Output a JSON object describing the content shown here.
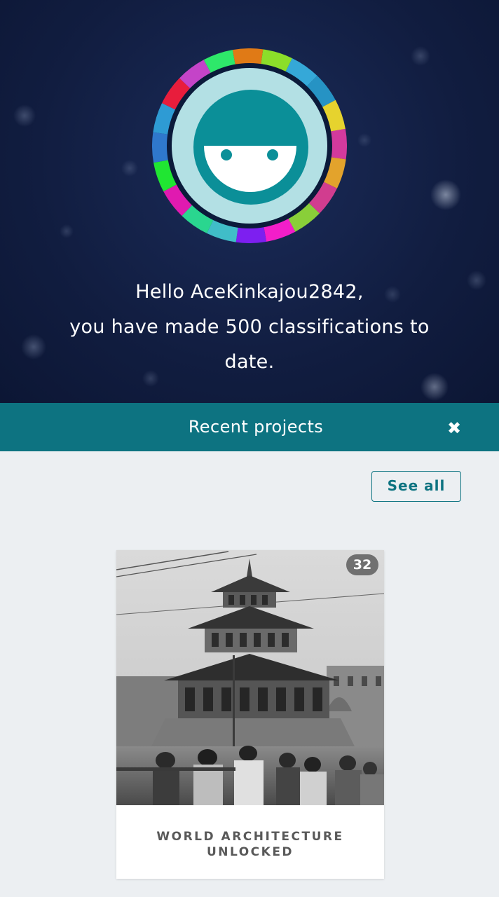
{
  "greeting": {
    "line1": "Hello AceKinkajou2842,",
    "line2": "you have made 500 classifications to",
    "line3": "date."
  },
  "recent_projects": {
    "title": "Recent projects",
    "close_icon": "times-icon",
    "see_all_label": "See all"
  },
  "project_card": {
    "badge": "32",
    "name_line1": "WORLD ARCHITECTURE",
    "name_line2": "UNLOCKED"
  },
  "colors": {
    "hero_bg": "#111d40",
    "accent": "#0d7381",
    "page_bg": "#eceff2",
    "avatar_teal": "#0b8f98",
    "avatar_light": "#b3e0e4"
  },
  "avatar": {
    "icon": "zooniverse-face-icon",
    "ring_colors": [
      "#e07a16",
      "#8cde2a",
      "#35a8d8",
      "#2693c4",
      "#e6d32e",
      "#d33a9d",
      "#e3a32c",
      "#d13d8f",
      "#89cf39",
      "#f21ec9",
      "#7d1ff0",
      "#40bdc8",
      "#2ad68f",
      "#e01ab0",
      "#20e632",
      "#2f78cc",
      "#2e9bd4",
      "#e81d3c",
      "#c444c8",
      "#2ee86a"
    ]
  }
}
